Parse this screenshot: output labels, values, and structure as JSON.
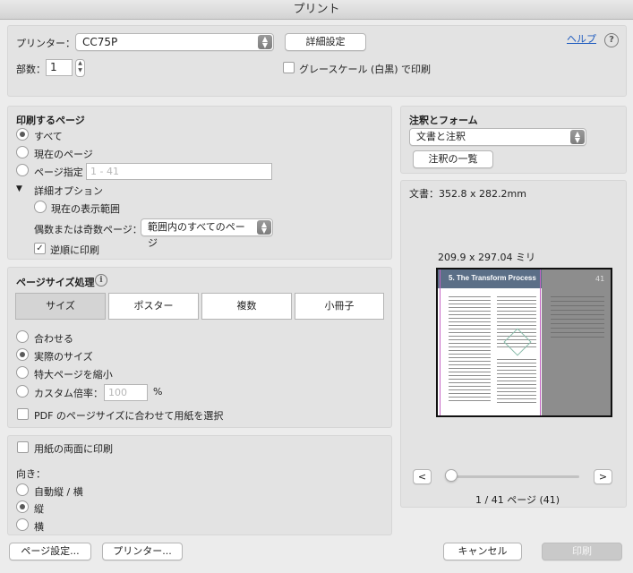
{
  "window": {
    "title": "プリント"
  },
  "top": {
    "printer_label": "プリンター：",
    "printer_value": "CC75P",
    "advanced_button": "詳細設定",
    "help_link": "ヘルプ",
    "help_icon": "?",
    "copies_label": "部数：",
    "copies_value": "1",
    "grayscale_label": "グレースケール (白黒) で印刷"
  },
  "pages": {
    "header": "印刷するページ",
    "all": "すべて",
    "current": "現在のページ",
    "range": "ページ指定",
    "range_placeholder": "1 - 41",
    "more_options": "詳細オプション",
    "current_view": "現在の表示範囲",
    "odd_even_label": "偶数または奇数ページ：",
    "odd_even_value": "範囲内のすべてのページ",
    "reverse": "逆順に印刷"
  },
  "sizing": {
    "header": "ページサイズ処理",
    "info_icon": "i",
    "tabs": [
      "サイズ",
      "ポスター",
      "複数",
      "小冊子"
    ],
    "fit": "合わせる",
    "actual": "実際のサイズ",
    "shrink": "特大ページを縮小",
    "custom": "カスタム倍率：",
    "custom_value": "100",
    "percent": "%",
    "choose_paper": "PDF のページサイズに合わせて用紙を選択"
  },
  "duplex": {
    "both_sides": "用紙の両面に印刷",
    "orientation_label": "向き：",
    "auto": "自動縦 / 横",
    "portrait": "縦",
    "landscape": "横"
  },
  "comments": {
    "header": "注釈とフォーム",
    "value": "文書と注釈",
    "summarize_button": "注釈の一覧"
  },
  "preview": {
    "doc_size": "文書：352.8 x 282.2mm",
    "page_size": "209.9 x 297.04 ミリ",
    "page_title": "5. The Transform Process",
    "page_number": "41",
    "prev": "<",
    "next": ">",
    "page_counter": "1 / 41 ページ (41)",
    "slider_value": 0
  },
  "bottom": {
    "page_setup": "ページ設定...",
    "printer": "プリンター...",
    "cancel": "キャンセル",
    "print": "印刷"
  }
}
